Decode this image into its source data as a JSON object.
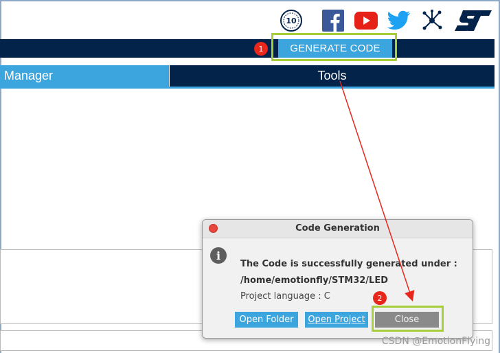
{
  "header": {
    "icons": [
      {
        "name": "ten-years-badge-icon",
        "text": "10"
      },
      {
        "name": "facebook-icon"
      },
      {
        "name": "youtube-icon"
      },
      {
        "name": "twitter-icon"
      },
      {
        "name": "network-share-icon"
      },
      {
        "name": "st-logo-icon",
        "text": "ST"
      }
    ],
    "generate_button_label": "GENERATE CODE",
    "step1_label": "1"
  },
  "tabs": {
    "manager_label": "Manager",
    "tools_label": "Tools"
  },
  "dialog": {
    "title": "Code Generation",
    "info_icon_glyph": "i",
    "message_line1": "The Code is successfully generated under :",
    "message_line2": "/home/emotionfly/STM32/LED",
    "message_line3": "Project language : C",
    "buttons": {
      "open_folder": "Open Folder",
      "open_project": "Open Project",
      "close": "Close"
    },
    "step2_label": "2"
  },
  "colors": {
    "navy": "#03234b",
    "accent_blue": "#3ca5de",
    "highlight_green": "#a6ce39",
    "annotation_red": "#e8261c",
    "close_grey": "#8a8a8a"
  },
  "watermark": "CSDN @EmotionFlying"
}
